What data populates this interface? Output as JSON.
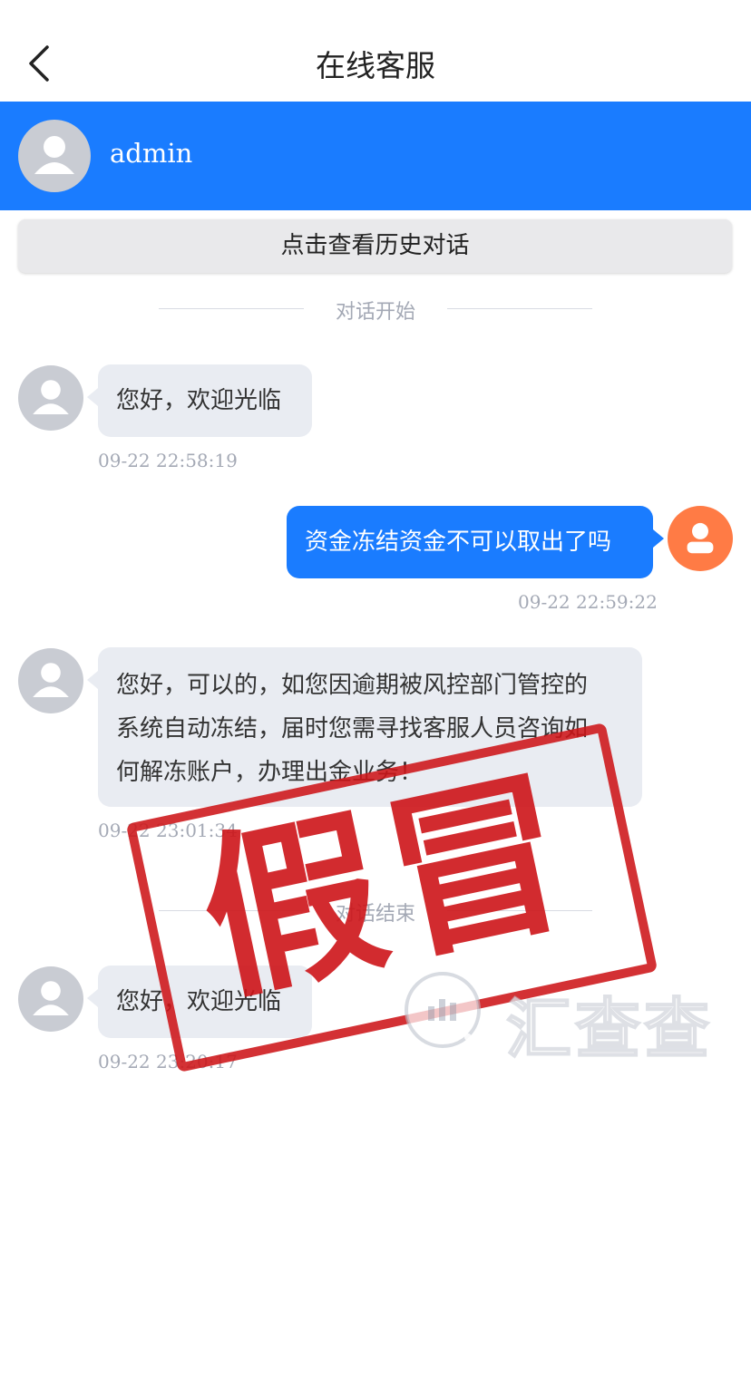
{
  "nav": {
    "title": "在线客服",
    "back_icon": "chevron-left-icon"
  },
  "agent": {
    "name": "admin",
    "avatar_icon": "user-icon"
  },
  "history_button": "点击查看历史对话",
  "dividers": {
    "start": "对话开始",
    "end": "对话结束"
  },
  "messages": [
    {
      "from": "agent",
      "text": "您好，欢迎光临",
      "time": "09-22 22:58:19"
    },
    {
      "from": "user",
      "text": "资金冻结资金不可以取出了吗",
      "time": "09-22 22:59:22"
    },
    {
      "from": "agent",
      "lines": [
        "您好，可以的，如您因逾期被风控部门管控的",
        "系统自动冻结，届时您需寻找客服人员咨询如",
        "何解冻账户，办理出金业务！"
      ],
      "time": "09-22 23:01:34"
    },
    {
      "from": "agent",
      "text": "您好，欢迎光临",
      "time": "09-22 23:20:17"
    }
  ],
  "overlay": {
    "stamp_text": "假冒",
    "watermark_text": "汇查查",
    "stamp_color": "#cd1418"
  },
  "colors": {
    "accent": "#1a7cff",
    "user_avatar": "#ff7b45",
    "agent_avatar": "#c9ccd3"
  }
}
